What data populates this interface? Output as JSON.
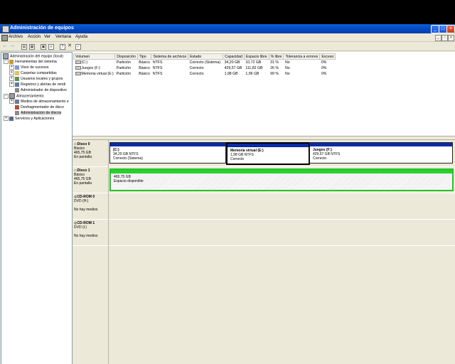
{
  "window": {
    "title": "Administración de equipos"
  },
  "menu": [
    "Archivo",
    "Acción",
    "Ver",
    "Ventana",
    "Ayuda"
  ],
  "tree": [
    {
      "label": "Administración del equipo (local)",
      "level": 0,
      "expander": ""
    },
    {
      "label": "Herramientas del sistema",
      "level": 1,
      "expander": "−"
    },
    {
      "label": "Visor de sucesos",
      "level": 2,
      "expander": "+"
    },
    {
      "label": "Carpetas compartidas",
      "level": 2,
      "expander": "+"
    },
    {
      "label": "Usuarios locales y grupos",
      "level": 2,
      "expander": "+"
    },
    {
      "label": "Registros y alertas de rendi",
      "level": 2,
      "expander": "+"
    },
    {
      "label": "Administrador de dispositivo",
      "level": 2,
      "expander": ""
    },
    {
      "label": "Almacenamiento",
      "level": 1,
      "expander": "−"
    },
    {
      "label": "Medios de almacenamiento e",
      "level": 2,
      "expander": "+"
    },
    {
      "label": "Desfragmentador de disco",
      "level": 2,
      "expander": ""
    },
    {
      "label": "Administración de discos",
      "level": 2,
      "expander": "",
      "selected": true
    },
    {
      "label": "Servicios y Aplicaciones",
      "level": 1,
      "expander": "+"
    }
  ],
  "volumes": {
    "headers": [
      "Volumen",
      "Disposición",
      "Tipo",
      "Sistema de archivos",
      "Estado",
      "Capacidad",
      "Espacio libre",
      "% libre",
      "Tolerancia a errores",
      "Exceso"
    ],
    "rows": [
      [
        "(C:)",
        "Partición",
        "Básico",
        "NTFS",
        "Correcto (Sistema)",
        "34,20 GB",
        "10,72 GB",
        "31 %",
        "No",
        "0%"
      ],
      [
        "Juegos (F:)",
        "Partición",
        "Básico",
        "NTFS",
        "Correcto",
        "429,57 GB",
        "111,82 GB",
        "26 %",
        "No",
        "0%"
      ],
      [
        "Memoria virtual (E:)",
        "Partición",
        "Básico",
        "NTFS",
        "Correcto",
        "1,98 GB",
        "1,96 GB",
        "99 %",
        "No",
        "0%"
      ]
    ]
  },
  "disks": [
    {
      "name": "Disco 0",
      "type": "Básico",
      "size": "465,75 GB",
      "status": "En pantalla",
      "partitions": [
        {
          "label": "(C:)",
          "size": "34,20 GB NTFS",
          "status": "Correcto (Sistema)"
        },
        {
          "label": "Memoria virtual (E:)",
          "size": "1,98 GB NTFS",
          "status": "Correcto"
        },
        {
          "label": "Juegos (F:)",
          "size": "429,57 GB NTFS",
          "status": "Correcto"
        }
      ]
    },
    {
      "name": "Disco 1",
      "type": "Básico",
      "size": "465,75 GB",
      "status": "En pantalla",
      "partitions": [
        {
          "label": "",
          "size": "465,75 GB",
          "status": "Espacio disponible"
        }
      ]
    },
    {
      "name": "CD-ROM 0",
      "type": "DVD (H:)",
      "size": "",
      "status": "No hay medios",
      "partitions": []
    },
    {
      "name": "CD-ROM 1",
      "type": "DVD (I:)",
      "size": "",
      "status": "No hay medios",
      "partitions": []
    }
  ],
  "colors": {
    "primary_partition": "#0b2aa8",
    "free_space": "#29d12f",
    "titlebar": "#0347c0"
  }
}
